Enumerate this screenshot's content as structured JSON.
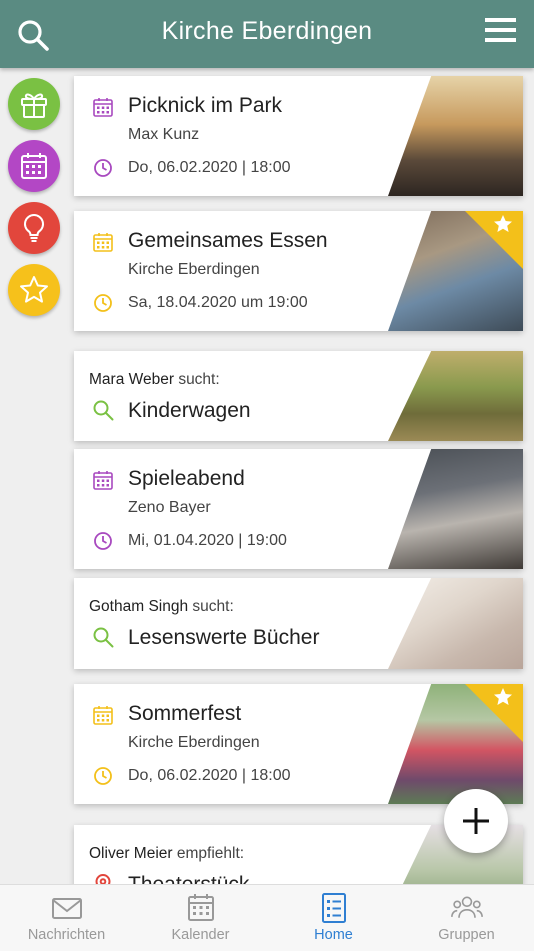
{
  "header": {
    "title": "Kirche Eberdingen"
  },
  "side_actions": [
    {
      "icon": "gift-icon",
      "color": "#7ac143"
    },
    {
      "icon": "calendar-icon",
      "color": "#b347c5"
    },
    {
      "icon": "lightbulb-icon",
      "color": "#e2463c"
    },
    {
      "icon": "star-icon",
      "color": "#f6c11b"
    }
  ],
  "feed": [
    {
      "type": "event",
      "title": "Picknick im Park",
      "subtitle": "Max Kunz",
      "datetime": "Do, 06.02.2020 | 18:00",
      "accent": "#a849bf"
    },
    {
      "type": "event",
      "title": "Gemeinsames Essen",
      "subtitle": "Kirche Eberdingen",
      "datetime": "Sa, 18.04.2020 um 19:00",
      "accent": "#f3c01a",
      "starred": true
    },
    {
      "type": "search",
      "person": "Mara Weber",
      "verb": "sucht:",
      "title": "Kinderwagen",
      "accent": "#7ac143"
    },
    {
      "type": "event",
      "title": "Spieleabend",
      "subtitle": "Zeno Bayer",
      "datetime": "Mi, 01.04.2020 | 19:00",
      "accent": "#a849bf"
    },
    {
      "type": "search",
      "person": "Gotham Singh",
      "verb": "sucht:",
      "title": "Lesenswerte Bücher",
      "accent": "#7ac143"
    },
    {
      "type": "event",
      "title": "Sommerfest",
      "subtitle": "Kirche Eberdingen",
      "datetime": "Do, 06.02.2020 | 18:00",
      "accent": "#f3c01a",
      "starred": true
    },
    {
      "type": "recommend",
      "person": "Oliver Meier",
      "verb": "empfiehlt:",
      "title": "Theaterstück",
      "accent": "#e2463c"
    }
  ],
  "tabs": [
    {
      "label": "Nachrichten",
      "icon": "mail-icon"
    },
    {
      "label": "Kalender",
      "icon": "calendar-icon"
    },
    {
      "label": "Home",
      "icon": "list-icon",
      "active": true
    },
    {
      "label": "Gruppen",
      "icon": "groups-icon"
    }
  ]
}
